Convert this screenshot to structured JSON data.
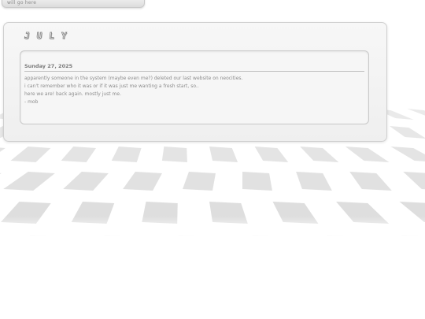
{
  "header": {
    "tab_text": "will go here"
  },
  "journal": {
    "month": "JULY",
    "entry": {
      "date": "Sunday 27, 2025",
      "lines": [
        "apparently someone in the system (maybe even me?) deleted our last website on neocities.",
        "i can't remember who it was or if it was just me wanting a fresh start, so..",
        "here we are! back again. mostly just me.",
        "- mob"
      ]
    }
  },
  "colors": {
    "floor_tile": "#d9d9d9",
    "floor_gap": "#ffffff",
    "panel": "#f2f2f2",
    "text": "#8c8c8c"
  }
}
